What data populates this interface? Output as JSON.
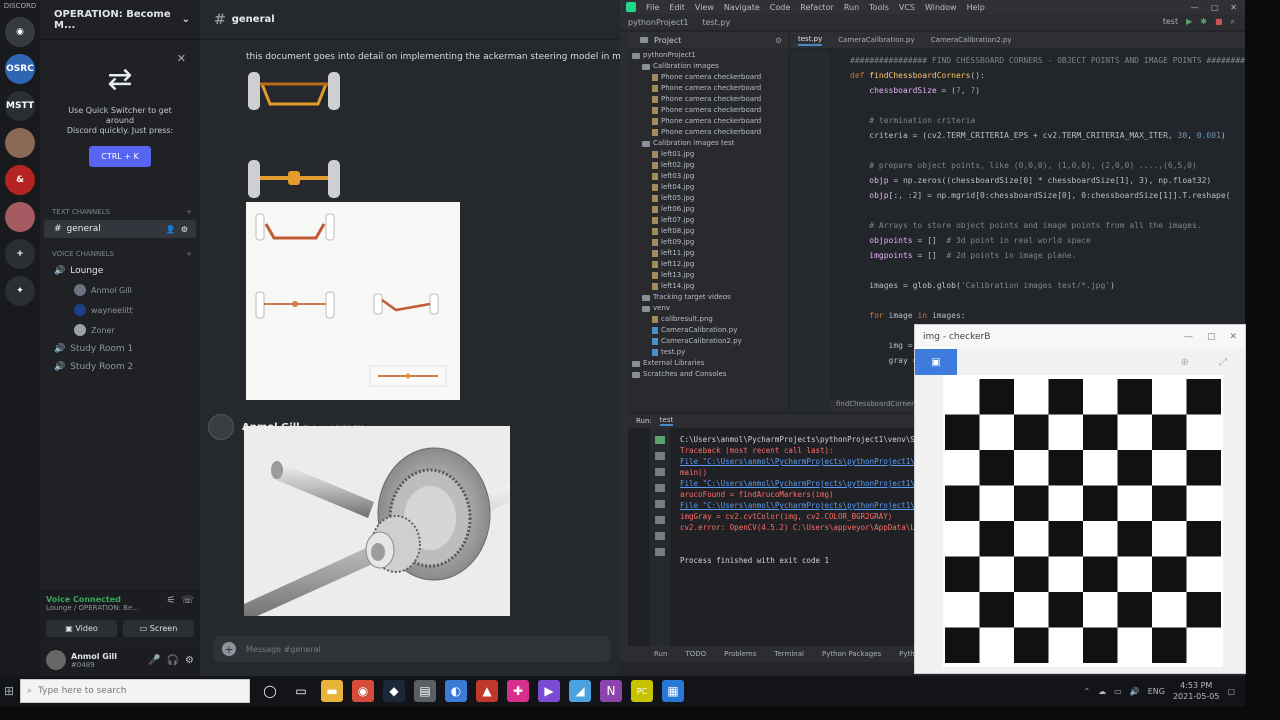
{
  "discord": {
    "rail_top_label": "DISCORD",
    "servers": [
      {
        "name": "home",
        "color": "#36393f",
        "text": "◉"
      },
      {
        "name": "server-osrc",
        "color": "#2f66b3",
        "text": "OSRC"
      },
      {
        "name": "server-mstt",
        "color": "#2b2e33",
        "text": "MSTT"
      },
      {
        "name": "server-avatar",
        "color": "#8a6a55",
        "text": ""
      },
      {
        "name": "server-dnd",
        "color": "#b62323",
        "text": "&"
      },
      {
        "name": "server-anime",
        "color": "#a55b62",
        "text": ""
      },
      {
        "name": "add-server",
        "color": "#2b2e33",
        "text": "+"
      },
      {
        "name": "explore",
        "color": "#2b2e33",
        "text": "✦"
      }
    ],
    "guild_name": "OPERATION: Become M...",
    "quick_switcher": {
      "line1": "Use Quick Switcher to get around",
      "line2": "Discord quickly. Just press:",
      "shortcut": "CTRL + K"
    },
    "text_category": "TEXT CHANNELS",
    "text_channels": [
      "general"
    ],
    "voice_category": "VOICE CHANNELS",
    "voice_channels": [
      {
        "name": "Lounge",
        "users": [
          "Anmol Gill",
          "wayneelitt",
          "Zoner"
        ]
      },
      {
        "name": "Study Room 1",
        "users": []
      },
      {
        "name": "Study Room 2",
        "users": []
      }
    ],
    "voice_panel": {
      "status": "Voice Connected",
      "location": "Lounge / OPERATION: Be...",
      "video_label": "Video",
      "screen_label": "Screen"
    },
    "user": {
      "name": "Anmol Gill",
      "tag": "#0489"
    },
    "chat_channel": "general",
    "message1": "this document goes into detail on implementing the ackerman steering model in matlab",
    "message2_author": "Anmol Gill",
    "message2_time": "Today at 3:20 PM",
    "composer_placeholder": "Message #general"
  },
  "taskbar": {
    "search_placeholder": "Type here to search",
    "apps": [
      {
        "name": "task-view",
        "color": "#121418",
        "glyph": "◯"
      },
      {
        "name": "taskbar-explorer",
        "color": "#121418",
        "glyph": "▭"
      },
      {
        "name": "file-explorer",
        "color": "#e8b339",
        "glyph": "▬"
      },
      {
        "name": "chrome",
        "color": "#d64b3a",
        "glyph": "◉"
      },
      {
        "name": "steam",
        "color": "#1b2838",
        "glyph": "◆"
      },
      {
        "name": "app-grey",
        "color": "#5a5f66",
        "glyph": "▤"
      },
      {
        "name": "app-blue",
        "color": "#3a7bd5",
        "glyph": "◐"
      },
      {
        "name": "app-red",
        "color": "#c0392b",
        "glyph": "▲"
      },
      {
        "name": "app-multicolor",
        "color": "#d6308c",
        "glyph": "✚"
      },
      {
        "name": "visual-studio",
        "color": "#7b4bd6",
        "glyph": "▶"
      },
      {
        "name": "app-lightblue",
        "color": "#4aa3df",
        "glyph": "◢"
      },
      {
        "name": "onenote",
        "color": "#8e44ad",
        "glyph": "N"
      },
      {
        "name": "pycharm",
        "color": "#c9c200",
        "glyph": "PC"
      },
      {
        "name": "photos",
        "color": "#2a78d6",
        "glyph": "▦"
      }
    ],
    "tray_lang": "ENG",
    "time": "4:53 PM",
    "date": "2021-05-05"
  },
  "pycharm": {
    "menu": [
      "File",
      "Edit",
      "View",
      "Navigate",
      "Code",
      "Refactor",
      "Run",
      "Tools",
      "VCS",
      "Window",
      "Help"
    ],
    "breadcrumb": [
      "pythonProject1",
      "test.py"
    ],
    "project_tab": "Project",
    "tree": [
      {
        "indent": 0,
        "kind": "fld",
        "label": "pythonProject1"
      },
      {
        "indent": 1,
        "kind": "fld",
        "label": "Calibration images"
      },
      {
        "indent": 2,
        "kind": "jpg",
        "label": "Phone camera checkerboard"
      },
      {
        "indent": 2,
        "kind": "jpg",
        "label": "Phone camera checkerboard"
      },
      {
        "indent": 2,
        "kind": "jpg",
        "label": "Phone camera checkerboard"
      },
      {
        "indent": 2,
        "kind": "jpg",
        "label": "Phone camera checkerboard"
      },
      {
        "indent": 2,
        "kind": "jpg",
        "label": "Phone camera checkerboard"
      },
      {
        "indent": 2,
        "kind": "jpg",
        "label": "Phone camera checkerboard"
      },
      {
        "indent": 1,
        "kind": "fld",
        "label": "Calibration images test"
      },
      {
        "indent": 2,
        "kind": "jpg",
        "label": "left01.jpg"
      },
      {
        "indent": 2,
        "kind": "jpg",
        "label": "left02.jpg"
      },
      {
        "indent": 2,
        "kind": "jpg",
        "label": "left03.jpg"
      },
      {
        "indent": 2,
        "kind": "jpg",
        "label": "left04.jpg"
      },
      {
        "indent": 2,
        "kind": "jpg",
        "label": "left05.jpg"
      },
      {
        "indent": 2,
        "kind": "jpg",
        "label": "left06.jpg"
      },
      {
        "indent": 2,
        "kind": "jpg",
        "label": "left07.jpg"
      },
      {
        "indent": 2,
        "kind": "jpg",
        "label": "left08.jpg"
      },
      {
        "indent": 2,
        "kind": "jpg",
        "label": "left09.jpg"
      },
      {
        "indent": 2,
        "kind": "jpg",
        "label": "left11.jpg"
      },
      {
        "indent": 2,
        "kind": "jpg",
        "label": "left12.jpg"
      },
      {
        "indent": 2,
        "kind": "jpg",
        "label": "left13.jpg"
      },
      {
        "indent": 2,
        "kind": "jpg",
        "label": "left14.jpg"
      },
      {
        "indent": 1,
        "kind": "fld",
        "label": "Tracking target videos"
      },
      {
        "indent": 1,
        "kind": "fld",
        "label": "venv"
      },
      {
        "indent": 2,
        "kind": "jpg",
        "label": "calibresult.png"
      },
      {
        "indent": 2,
        "kind": "py",
        "label": "CameraCalibration.py"
      },
      {
        "indent": 2,
        "kind": "py",
        "label": "CameraCalibration2.py"
      },
      {
        "indent": 2,
        "kind": "py",
        "label": "test.py"
      },
      {
        "indent": 0,
        "kind": "fld",
        "label": "External Libraries"
      },
      {
        "indent": 0,
        "kind": "fld",
        "label": "Scratches and Consoles"
      }
    ],
    "editor_tabs": [
      "test.py",
      "CameraCalibration.py",
      "CameraCalibration2.py"
    ],
    "code": [
      {
        "segs": [
          {
            "c": "cm",
            "t": "################ FIND CHESSBOARD CORNERS - OBJECT POINTS AND IMAGE POINTS ################"
          }
        ]
      },
      {
        "segs": [
          {
            "c": "kw",
            "t": "def "
          },
          {
            "c": "fn",
            "t": "findChessboardCorners"
          },
          {
            "c": "",
            "t": "():"
          }
        ]
      },
      {
        "segs": [
          {
            "c": "",
            "t": "    "
          },
          {
            "c": "var",
            "t": "chessboardSize"
          },
          {
            "c": "",
            "t": " = ("
          },
          {
            "c": "num",
            "t": "7"
          },
          {
            "c": "",
            "t": ", "
          },
          {
            "c": "num",
            "t": "7"
          },
          {
            "c": "",
            "t": ")"
          }
        ]
      },
      {
        "segs": []
      },
      {
        "segs": [
          {
            "c": "cm",
            "t": "    # termination criteria"
          }
        ]
      },
      {
        "segs": [
          {
            "c": "",
            "t": "    criteria = (cv2.TERM_CRITERIA_EPS + cv2.TERM_CRITERIA_MAX_ITER, "
          },
          {
            "c": "num",
            "t": "30"
          },
          {
            "c": "",
            "t": ", "
          },
          {
            "c": "num",
            "t": "0.001"
          },
          {
            "c": "",
            "t": ")"
          }
        ]
      },
      {
        "segs": []
      },
      {
        "segs": [
          {
            "c": "cm",
            "t": "    # prepare object points, like (0,0,0), (1,0,0), (2,0,0) ....,(6,5,0)"
          }
        ]
      },
      {
        "segs": [
          {
            "c": "",
            "t": "    "
          },
          {
            "c": "var",
            "t": "objp"
          },
          {
            "c": "",
            "t": " = np.zeros((chessboardSize[0] * chessboardSize[1], 3), np.float32)"
          }
        ]
      },
      {
        "segs": [
          {
            "c": "",
            "t": "    "
          },
          {
            "c": "var",
            "t": "objp"
          },
          {
            "c": "",
            "t": "[:, :2] = np.mgrid[0:chessboardSize[0], 0:chessboardSize[1]].T.reshape("
          }
        ]
      },
      {
        "segs": []
      },
      {
        "segs": [
          {
            "c": "cm",
            "t": "    # Arrays to store object points and image points from all the images."
          }
        ]
      },
      {
        "segs": [
          {
            "c": "",
            "t": "    "
          },
          {
            "c": "var",
            "t": "objpoints"
          },
          {
            "c": "",
            "t": " = []  "
          },
          {
            "c": "cm",
            "t": "# 3d point in real world space"
          }
        ]
      },
      {
        "segs": [
          {
            "c": "",
            "t": "    "
          },
          {
            "c": "var",
            "t": "imgpoints"
          },
          {
            "c": "",
            "t": " = []  "
          },
          {
            "c": "cm",
            "t": "# 2d points in image plane."
          }
        ]
      },
      {
        "segs": []
      },
      {
        "segs": [
          {
            "c": "",
            "t": "    images = glob.glob("
          },
          {
            "c": "cm",
            "t": "'Calibration images test/*.jpg'"
          },
          {
            "c": "",
            "t": ")"
          }
        ]
      },
      {
        "segs": []
      },
      {
        "segs": [
          {
            "c": "kw",
            "t": "    for "
          },
          {
            "c": "",
            "t": "image "
          },
          {
            "c": "kw",
            "t": "in "
          },
          {
            "c": "",
            "t": "images:"
          }
        ]
      },
      {
        "segs": []
      },
      {
        "segs": [
          {
            "c": "",
            "t": "        img = cv2.imread(image)"
          }
        ]
      },
      {
        "segs": [
          {
            "c": "",
            "t": "        gray = cv2.cvtColor(img, cv2.COLOR_BGR2GRAY)"
          }
        ]
      }
    ],
    "editor_crumb": "findChessboardCorners()  ›  for image in images",
    "run_label": "Run:",
    "run_name": "test",
    "console": [
      {
        "c": "path",
        "t": "C:\\Users\\anmol\\PycharmProjects\\pythonProject1\\venv\\Scripts\\python.exe"
      },
      {
        "c": "err",
        "t": "Traceback (most recent call last):"
      },
      {
        "c": "link",
        "t": "  File \"C:\\Users\\anmol\\PycharmProjects\\pythonProject1\\test.py\""
      },
      {
        "c": "err",
        "t": "    main()"
      },
      {
        "c": "link",
        "t": "  File \"C:\\Users\\anmol\\PycharmProjects\\pythonProject1\\test.py\""
      },
      {
        "c": "err",
        "t": "    arucoFound = findArucoMarkers(img)"
      },
      {
        "c": "link",
        "t": "  File \"C:\\Users\\anmol\\PycharmProjects\\pythonProject1\\test.py\""
      },
      {
        "c": "err",
        "t": "    imgGray = cv2.cvtColor(img, cv2.COLOR_BGR2GRAY)"
      },
      {
        "c": "err",
        "t": "cv2.error: OpenCV(4.5.2) C:\\Users\\appveyor\\AppData\\Local\\Temp"
      },
      {
        "c": "ok",
        "t": ""
      },
      {
        "c": "ok",
        "t": ""
      },
      {
        "c": "ok",
        "t": "Process finished with exit code 1"
      }
    ],
    "bottom_tabs": [
      "Run",
      "TODO",
      "Problems",
      "Terminal",
      "Python Packages",
      "Python Console"
    ]
  },
  "chess_window": {
    "title": "img - checkerB",
    "squares_per_side": 8
  }
}
